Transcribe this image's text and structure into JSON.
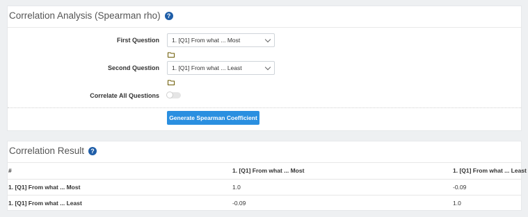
{
  "analysis": {
    "title": "Correlation Analysis (Spearman rho)",
    "help": "?",
    "first_question": {
      "label": "First Question",
      "value": "1. [Q1] From what ... Most"
    },
    "second_question": {
      "label": "Second Question",
      "value": "1. [Q1] From what ... Least"
    },
    "correlate_all": {
      "label": "Correlate All Questions",
      "enabled": false
    },
    "generate_button": "Generate Spearman Coefficient"
  },
  "result": {
    "title": "Correlation Result",
    "help": "?",
    "headers": [
      "#",
      "1. [Q1] From what ... Most",
      "1. [Q1] From what ... Least"
    ],
    "rows": [
      [
        "1. [Q1] From what ... Most",
        "1.0",
        "-0.09"
      ],
      [
        "1. [Q1] From what ... Least",
        "-0.09",
        "1.0"
      ]
    ]
  },
  "colors": {
    "accent": "#2a8fe0",
    "help": "#1f5ea8",
    "folder": "#6b5a00"
  },
  "icons": [
    "help-icon",
    "folder-icon",
    "chevron-down-icon"
  ]
}
